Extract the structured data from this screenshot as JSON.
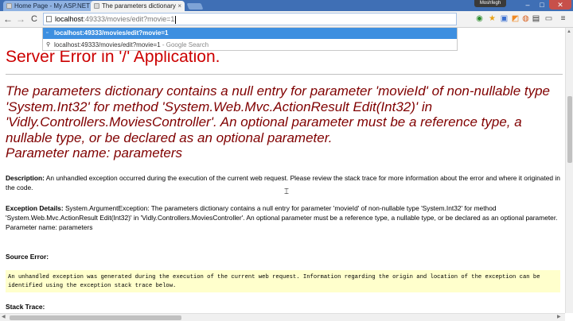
{
  "tabs": [
    {
      "title": "Home Page - My ASP.NET",
      "active": false,
      "close_glyph": "×"
    },
    {
      "title": "The parameters dictionary",
      "active": true,
      "close_glyph": "×"
    }
  ],
  "user_badge": "Moshfegh",
  "window_controls": {
    "minimize": "–",
    "maximize": "□",
    "close": "✕"
  },
  "nav": {
    "back": "←",
    "forward": "→",
    "reload": "C"
  },
  "address_bar": {
    "host": "localhost",
    "rest": ":49333/movies/edit?movie=1"
  },
  "extensions": [
    "chrome-icon",
    "star-icon",
    "bookmark-icon",
    "rss-icon",
    "firefox-icon",
    "save-icon",
    "cast-icon",
    "menu-icon"
  ],
  "autocomplete": [
    {
      "text": "localhost:49333/movies/edit?movie=1",
      "sub": "",
      "icon": "page-icon"
    },
    {
      "text": "localhost:49333/movies/edit?movie=1",
      "sub": " - Google Search",
      "icon": "search-icon"
    }
  ],
  "page": {
    "title": "Server Error in '/' Application.",
    "message": "The parameters dictionary contains a null entry for parameter 'movieId' of non-nullable type 'System.Int32' for method 'System.Web.Mvc.ActionResult Edit(Int32)' in 'Vidly.Controllers.MoviesController'. An optional parameter must be a reference type, a nullable type, or be declared as an optional parameter.",
    "param_line": "Parameter name: parameters",
    "description_label": "Description:",
    "description_text": "An unhandled exception occurred during the execution of the current web request. Please review the stack trace for more information about the error and where it originated in the code.",
    "exception_label": "Exception Details:",
    "exception_text": "System.ArgumentException: The parameters dictionary contains a null entry for parameter 'movieId' of non-nullable type 'System.Int32' for method 'System.Web.Mvc.ActionResult Edit(Int32)' in 'Vidly.Controllers.MoviesController'. An optional parameter must be a reference type, a nullable type, or be declared as an optional parameter.",
    "exception_param": "Parameter name: parameters",
    "source_label": "Source Error:",
    "source_text": "An unhandled exception was generated during the execution of the current web request. Information regarding the origin and location of the exception can be identified using the exception stack trace below.",
    "stack_label": "Stack Trace:"
  },
  "colors": {
    "title_red": "#cc0000",
    "message_maroon": "#800000",
    "source_bg": "#ffffcc",
    "tabstrip": "#3f6fb5",
    "autocomplete_highlight": "#3d8fe0"
  }
}
